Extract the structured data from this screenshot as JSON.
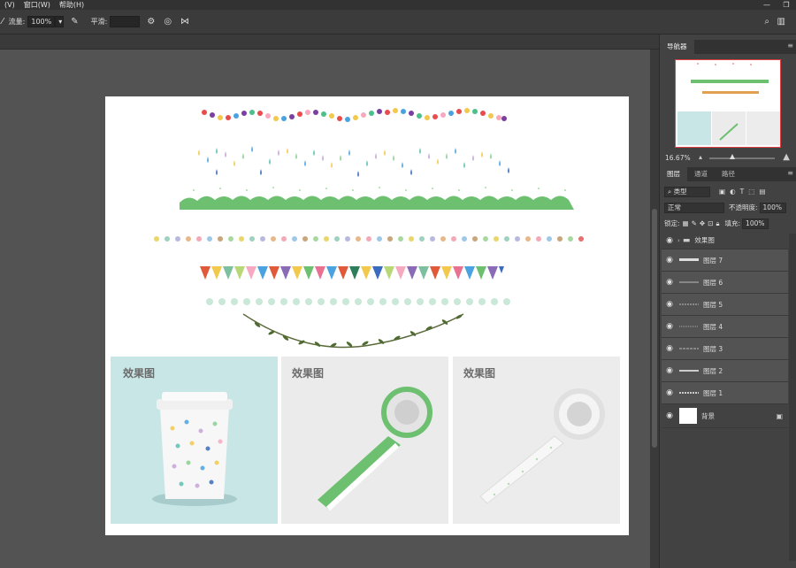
{
  "menu": {
    "items": [
      "(V)",
      "窗口(W)",
      "帮助(H)"
    ],
    "window_controls": [
      "—",
      "❐"
    ]
  },
  "options": {
    "flow_label": "流量:",
    "flow_value": "100%",
    "smooth_label": "平滑:",
    "smooth_value": ""
  },
  "navigator": {
    "tab": "导航器",
    "zoom": "16.67%"
  },
  "layers_panel": {
    "tabs": [
      "图层",
      "通道",
      "路径"
    ],
    "filter_kind": "类型",
    "blend_mode": "正常",
    "opacity_label": "不透明度:",
    "opacity_value": "100%",
    "lock_label": "锁定:",
    "fill_label": "填充:",
    "fill_value": "100%",
    "layers": [
      {
        "name": "效果图",
        "type": "group"
      },
      {
        "name": "图层 7",
        "type": "layer"
      },
      {
        "name": "图层 6",
        "type": "layer"
      },
      {
        "name": "图层 5",
        "type": "layer"
      },
      {
        "name": "图层 4",
        "type": "layer"
      },
      {
        "name": "图层 3",
        "type": "layer"
      },
      {
        "name": "图层 2",
        "type": "layer"
      },
      {
        "name": "图层 1",
        "type": "layer"
      },
      {
        "name": "背景",
        "type": "background"
      }
    ]
  },
  "document": {
    "effect_labels": [
      "效果图",
      "效果图",
      "效果图"
    ]
  },
  "colors": {
    "accent_green": "#6cc070",
    "panel_bg": "#424242",
    "canvas_bg": "#535353"
  }
}
